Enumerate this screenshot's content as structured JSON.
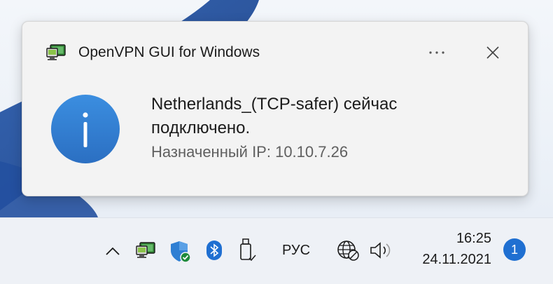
{
  "toast": {
    "app_name": "OpenVPN GUI for Windows",
    "message_line1": "Netherlands_(TCP-safer) сейчас",
    "message_line2": "подключено.",
    "detail": "Назначенный IP: 10.10.7.26",
    "icons": {
      "app": "openvpn-monitor-icon",
      "main": "info-icon",
      "more": "more-icon",
      "close": "close-icon"
    }
  },
  "taskbar": {
    "language": "РУС",
    "time": "16:25",
    "date": "24.11.2021",
    "notification_count": "1",
    "tray_icons": [
      "chevron-up-icon",
      "openvpn-tray-icon",
      "defender-shield-icon",
      "bluetooth-icon",
      "usb-drive-icon",
      "globe-icon",
      "volume-icon"
    ]
  },
  "colors": {
    "accent": "#1f6fd1",
    "info_blue": "#2f7fd3",
    "toast_bg": "#f3f3f3",
    "taskbar_bg": "#eef1f6",
    "secondary_text": "#606060"
  }
}
